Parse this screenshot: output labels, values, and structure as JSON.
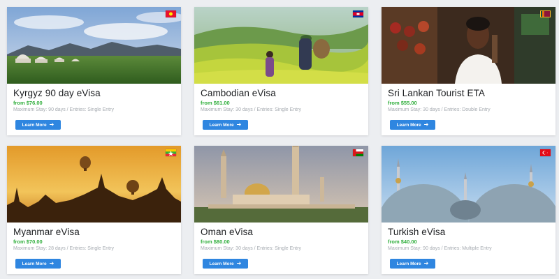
{
  "cards": [
    {
      "title": "Kyrgyz 90 day eVisa",
      "price": "from $76.00",
      "meta": "Maximum Stay: 90 days / Entries: Single Entry",
      "button": "Learn More",
      "arrow": "➔",
      "flag_colors": {
        "bg": "#e8112d",
        "fg": "#ffef00"
      }
    },
    {
      "title": "Cambodian eVisa",
      "price": "from $61.00",
      "meta": "Maximum Stay: 30 days / Entries: Single Entry",
      "button": "Learn More",
      "arrow": "➔",
      "flag_colors": {
        "top": "#032ea1",
        "mid": "#e00025"
      }
    },
    {
      "title": "Sri Lankan Tourist ETA",
      "price": "from $55.00",
      "meta": "Maximum Stay: 30 days / Entries: Double Entry",
      "button": "Learn More",
      "arrow": "➔",
      "flag_colors": {
        "left": "#00534e",
        "mid": "#eb7400",
        "main": "#8d153a",
        "border": "#ffbe29"
      }
    },
    {
      "title": "Myanmar eVisa",
      "price": "from $70.00",
      "meta": "Maximum Stay: 28 days / Entries: Single Entry",
      "button": "Learn More",
      "arrow": "➔",
      "flag_colors": {
        "top": "#fecb00",
        "mid": "#34b233",
        "bottom": "#ea2839"
      }
    },
    {
      "title": "Oman eVisa",
      "price": "from $80.00",
      "meta": "Maximum Stay: 30 days / Entries: Single Entry",
      "button": "Learn More",
      "arrow": "➔",
      "flag_colors": {
        "left": "#db161b",
        "top": "#ffffff",
        "bottom": "#008000"
      }
    },
    {
      "title": "Turkish eVisa",
      "price": "from $40.00",
      "meta": "Maximum Stay: 90 days / Entries: Multiple Entry",
      "button": "Learn More",
      "arrow": "➔",
      "flag_colors": {
        "bg": "#e30a17",
        "fg": "#ffffff"
      }
    }
  ],
  "colors": {
    "price": "#2fae3b",
    "button": "#2f86e0",
    "page_bg": "#eceef1"
  }
}
